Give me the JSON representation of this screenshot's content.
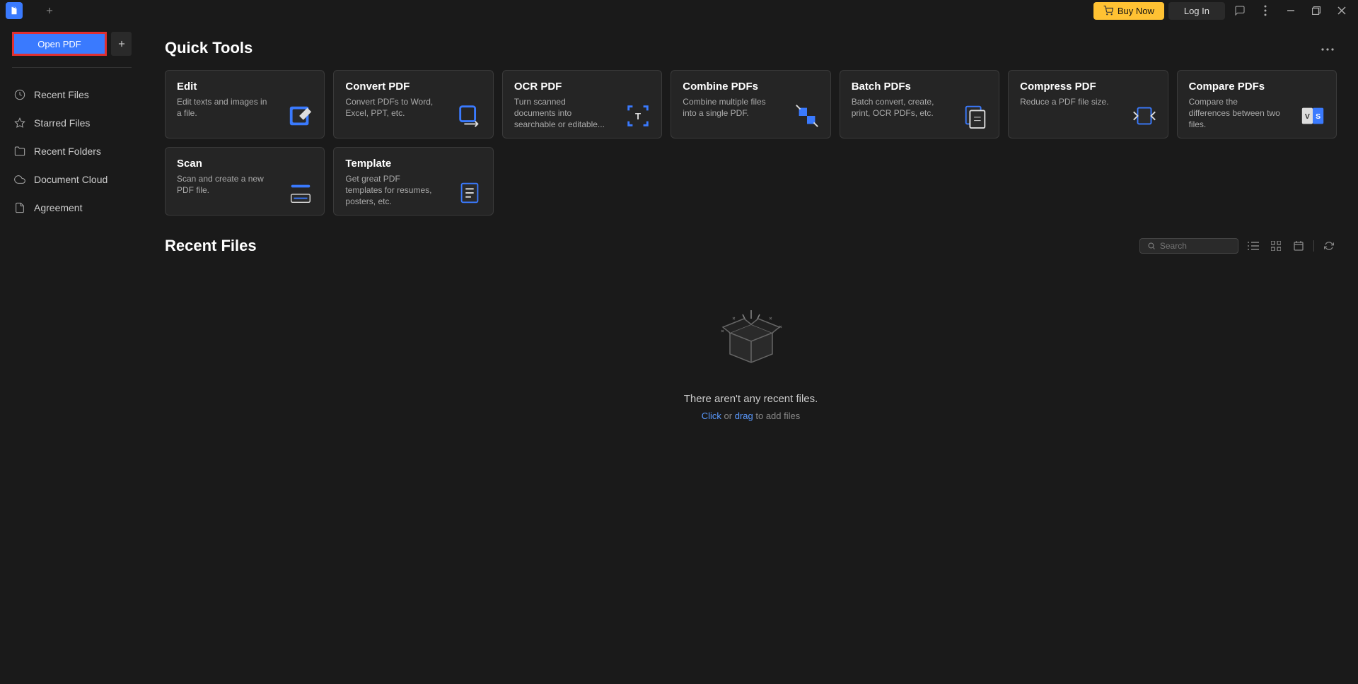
{
  "titlebar": {
    "buy_label": "Buy Now",
    "login_label": "Log In"
  },
  "sidebar": {
    "open_pdf_label": "Open PDF",
    "items": [
      {
        "label": "Recent Files"
      },
      {
        "label": "Starred Files"
      },
      {
        "label": "Recent Folders"
      },
      {
        "label": "Document Cloud"
      },
      {
        "label": "Agreement"
      }
    ]
  },
  "main": {
    "quick_tools_title": "Quick Tools",
    "tools": [
      {
        "title": "Edit",
        "desc": "Edit texts and images in a file."
      },
      {
        "title": "Convert PDF",
        "desc": "Convert PDFs to Word, Excel, PPT, etc."
      },
      {
        "title": "OCR PDF",
        "desc": "Turn scanned documents into searchable or editable..."
      },
      {
        "title": "Combine PDFs",
        "desc": "Combine multiple files into a single PDF."
      },
      {
        "title": "Batch PDFs",
        "desc": "Batch convert, create, print, OCR PDFs, etc."
      },
      {
        "title": "Compress PDF",
        "desc": "Reduce a PDF file size."
      },
      {
        "title": "Compare PDFs",
        "desc": "Compare the differences between two files."
      },
      {
        "title": "Scan",
        "desc": "Scan and create a new PDF file."
      },
      {
        "title": "Template",
        "desc": "Get great PDF templates for resumes, posters, etc."
      }
    ],
    "recent_files_title": "Recent Files",
    "search_placeholder": "Search",
    "empty_message": "There aren't any recent files.",
    "empty_click": "Click",
    "empty_or": " or ",
    "empty_drag": "drag",
    "empty_tail": " to add files"
  }
}
